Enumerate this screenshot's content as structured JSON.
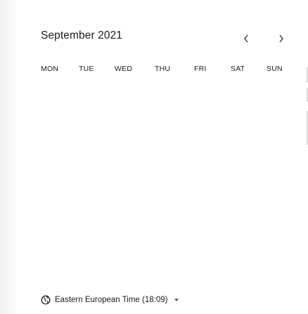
{
  "calendar": {
    "month_label": "September 2021",
    "prev_icon": "chevron-left-icon",
    "next_icon": "chevron-right-icon",
    "weekdays": [
      "MON",
      "TUE",
      "WED",
      "THU",
      "FRI",
      "SAT",
      "SUN"
    ]
  },
  "timezone": {
    "icon": "globe-icon",
    "label": "Eastern European Time (18:09)",
    "dropdown_icon": "caret-down-icon"
  },
  "colors": {
    "text": "#1a1a1a",
    "background": "#ffffff"
  }
}
